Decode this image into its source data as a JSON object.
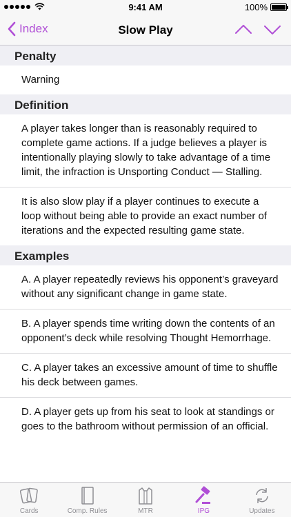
{
  "status": {
    "time": "9:41 AM",
    "battery": "100%"
  },
  "nav": {
    "back_label": "Index",
    "title": "Slow Play"
  },
  "sections": {
    "penalty": {
      "header": "Penalty",
      "value": "Warning"
    },
    "definition": {
      "header": "Definition",
      "paragraphs": [
        "A player takes longer than is reasonably required to complete game actions. If a judge believes a player is intentionally playing slowly to take advantage of a time limit, the infraction is Unsporting Conduct — Stalling.",
        "It is also slow play if a player continues to execute a loop without being able to provide an exact number of iterations and the expected resulting game state."
      ]
    },
    "examples": {
      "header": "Examples",
      "items": [
        "A. A player repeatedly reviews his opponent’s graveyard without any significant change in game state.",
        "B. A player spends time writing down the contents of an opponent’s deck while resolving Thought Hemorrhage.",
        "C. A player takes an excessive amount of time to shuffle his deck between games.",
        "D. A player gets up from his seat to look at standings or goes to the bathroom without permission of an official."
      ]
    }
  },
  "tabs": [
    {
      "label": "Cards",
      "icon": "cards-icon"
    },
    {
      "label": "Comp. Rules",
      "icon": "book-icon"
    },
    {
      "label": "MTR",
      "icon": "shirt-icon"
    },
    {
      "label": "IPG",
      "icon": "gavel-icon"
    },
    {
      "label": "Updates",
      "icon": "refresh-icon"
    }
  ],
  "active_tab": "IPG",
  "colors": {
    "accent": "#b04fd6",
    "section_bg": "#efeff4",
    "inactive_tab": "#8e8e93"
  }
}
